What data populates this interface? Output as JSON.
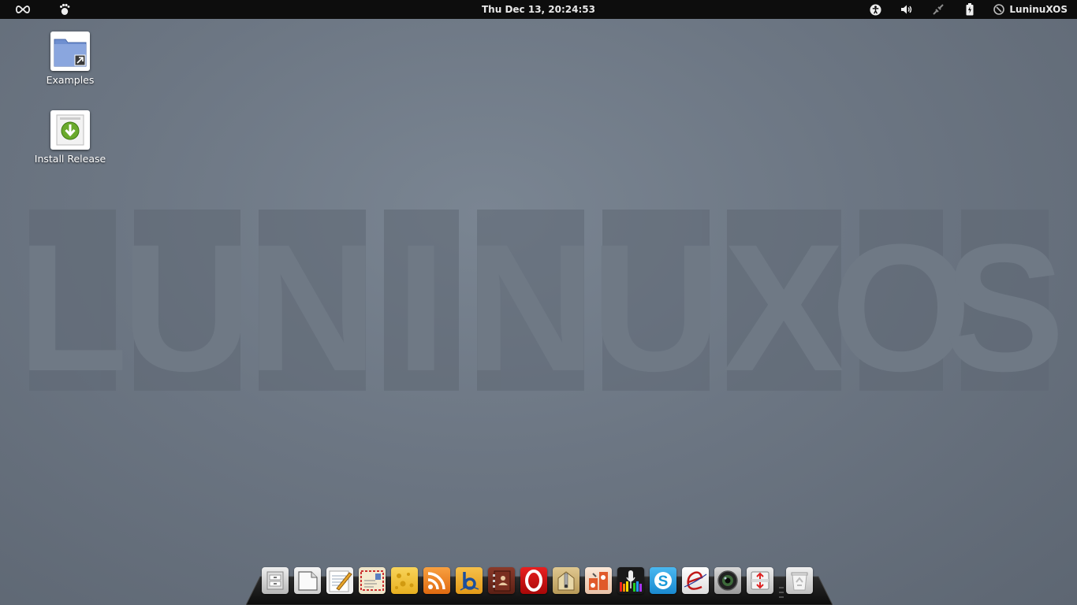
{
  "top_panel": {
    "clock": "Thu Dec 13, 20:24:53",
    "user_name": "LuninuXOS"
  },
  "desktop_icons": [
    {
      "label": "Examples",
      "icon": "folder-shortcut-icon"
    },
    {
      "label": "Install Release",
      "icon": "install-download-icon"
    }
  ],
  "watermark": {
    "text": "LUNINUXOS",
    "letters": [
      "L",
      "U",
      "N",
      "I",
      "N",
      "U",
      "X",
      "O",
      "S"
    ]
  },
  "dock": {
    "items": [
      {
        "name": "file-manager-icon"
      },
      {
        "name": "document-icon"
      },
      {
        "name": "text-editor-icon"
      },
      {
        "name": "mail-icon"
      },
      {
        "name": "cheese-icon"
      },
      {
        "name": "rss-icon"
      },
      {
        "name": "b-app-icon"
      },
      {
        "name": "address-book-icon"
      },
      {
        "name": "opera-icon"
      },
      {
        "name": "archive-icon"
      },
      {
        "name": "settings-icon"
      },
      {
        "name": "audio-recorder-icon"
      },
      {
        "name": "skype-icon"
      },
      {
        "name": "browser-e-icon"
      },
      {
        "name": "webcam-icon"
      },
      {
        "name": "updater-icon"
      },
      {
        "name": "trash-icon"
      }
    ]
  },
  "colors": {
    "panel": "#0d0d0d",
    "desktop_bg": "#6c7683",
    "dock": "#1a1a1a"
  }
}
